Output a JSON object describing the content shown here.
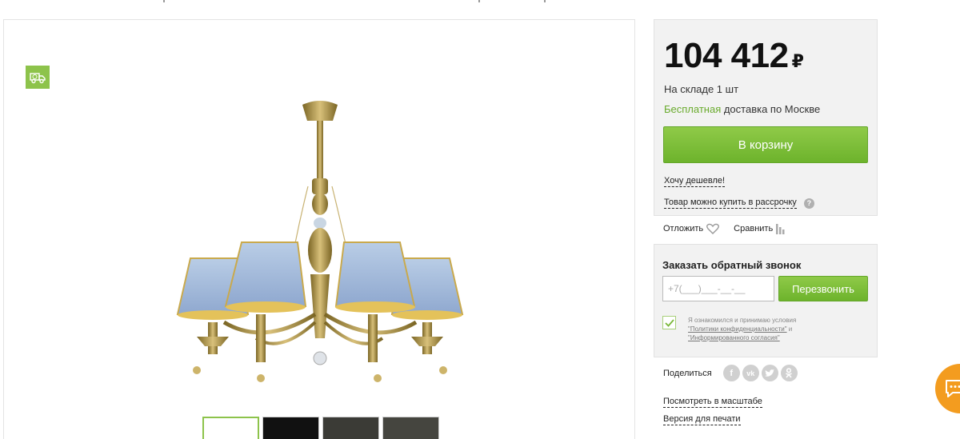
{
  "colors": {
    "accent_green": "#7ab83a",
    "free_text_green": "#6aab2e",
    "panel_bg": "#f2f2f2",
    "chat_orange": "#f39c1f",
    "badge_green": "#8dc34b"
  },
  "gallery": {
    "badge_icon": "delivery-truck-icon",
    "main_image": "brass chandelier with blue shades",
    "thumbnails": [
      {
        "active": true
      },
      {
        "active": false
      },
      {
        "active": false
      },
      {
        "active": false
      }
    ]
  },
  "buy_box": {
    "price": "104 412",
    "currency": "₽",
    "stock": "На складе 1 шт",
    "delivery_free": "Бесплатная",
    "delivery_rest": " доставка по Москве",
    "cart_button": "В корзину",
    "cheaper_link": "Хочу дешевле!",
    "installment_link": "Товар можно купить в рассрочку",
    "help_icon": "?"
  },
  "actions": {
    "postpone": "Отложить",
    "compare": "Сравнить"
  },
  "callback": {
    "title": "Заказать обратный звонок",
    "phone_placeholder": "+7(___)___-__-__",
    "button": "Перезвонить",
    "consent_line1": "Я ознакомился и принимаю условия",
    "consent_link1": "\"Политики конфиденциальности\"",
    "consent_and": " и",
    "consent_link2": "\"Информированного согласия\""
  },
  "share": {
    "label": "Поделиться",
    "networks": [
      "f",
      "vk",
      "tw",
      "ok"
    ]
  },
  "links": {
    "zoom": "Посмотреть в масштабе",
    "print": "Версия для печати"
  }
}
